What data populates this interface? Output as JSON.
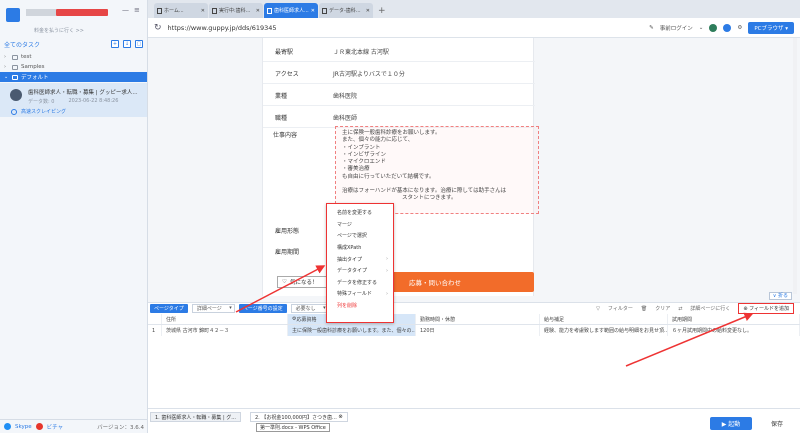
{
  "sidebar": {
    "user_sub": "料金を払うに行く >>",
    "tasks_title": "全てのタスク",
    "tree": [
      {
        "label": "test",
        "chevron": "›"
      },
      {
        "label": "Samples",
        "chevron": "›"
      },
      {
        "label": "デフォルト",
        "chevron": "⌄"
      }
    ],
    "task": {
      "title": "歯科医師求人・転職・募集 | グッピー求人...",
      "count_label": "データ数: 0",
      "date": "2023-06-22 8:48:26",
      "status": "高速スクレイピング"
    },
    "footer": {
      "skype": "Skype",
      "wechat": "ビチャ",
      "version": "バージョン：3.6.4"
    }
  },
  "tabs": [
    {
      "label": "ホーム..."
    },
    {
      "label": "実行中:歯科..."
    },
    {
      "label": "歯科医師求人..."
    },
    {
      "label": "データ-歯科..."
    }
  ],
  "tab_plus": "+",
  "address": {
    "url": "https://www.guppy.jp/dds/619345",
    "login": "事前ログイン",
    "pc_browser": "PCブラウザ"
  },
  "page": {
    "rows": [
      {
        "label": "最寄駅",
        "value": "ＪＲ東北本線 古河駅"
      },
      {
        "label": "アクセス",
        "value": "JR古河駅よりバスで１０分"
      },
      {
        "label": "業種",
        "value": "歯科医院"
      },
      {
        "label": "職種",
        "value": "歯科医師"
      }
    ],
    "job_label": "仕事内容",
    "job_lines": [
      "主に保険一般歯科診療をお願いします。",
      "また、個々の能力に応じて、",
      "・インプラント",
      "・インビザライン",
      "・マイクロエンド",
      "・審美治療",
      "も自由に行っていただいて結構です。",
      "",
      "治療はフォーハンドが基本になります。治療に際しては助手さんは",
      "スタントにつきます。"
    ],
    "employment_label": "雇用形態",
    "period_label": "雇用期間",
    "fav_label": "気になる！",
    "apply_label": "応募・問い合わせ"
  },
  "context_menu": [
    {
      "label": "名前を変更する",
      "arrow": ""
    },
    {
      "label": "マージ",
      "arrow": ""
    },
    {
      "label": "ページで選択",
      "arrow": ""
    },
    {
      "label": "構成XPath",
      "arrow": ""
    },
    {
      "label": "抽出タイプ",
      "arrow": "›"
    },
    {
      "label": "データタイプ",
      "arrow": "›"
    },
    {
      "label": "データを修正する",
      "arrow": ""
    },
    {
      "label": "特殊フィールド",
      "arrow": "›"
    },
    {
      "label": "列を削除",
      "arrow": ""
    }
  ],
  "panel": {
    "collapse": "∨ 折る",
    "page_type": "ページタイプ",
    "page_select": "詳細ページ",
    "paging_setting": "ページ番号の設定",
    "none_option": "必要なし",
    "toolbar_right": [
      "フィルター",
      "クリア",
      "詳細ページに行く"
    ],
    "add_field": "フィールドを追加",
    "columns": [
      "",
      "住所",
      "応募資格",
      "勤務時間・休憩",
      "給与補足",
      "試用期間"
    ],
    "rows": [
      [
        "1",
        "茨城県 古河市 錦町４２－３",
        "主に保険一般歯科診療をお願いします。また、個々の...",
        "120日",
        "経験、能力を考慮致します範囲の給与明細をお見せ頂...",
        "６ヶ月試用期間中の給料変更なし。"
      ]
    ]
  },
  "bottom": {
    "tab1": "1. 歯科医師求人・転職・募集 | グ...",
    "tab2": "2. 【お祝金100,000円】さつき歯...",
    "wps_tip": "第一準則.docx - WPS Office",
    "start": "▶ 起動",
    "save": "保存"
  }
}
